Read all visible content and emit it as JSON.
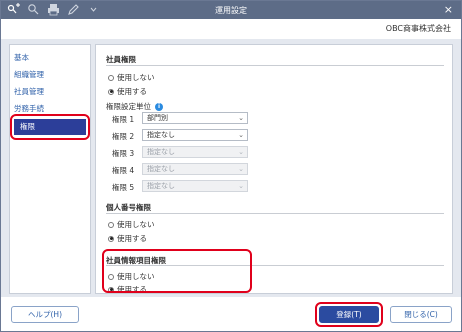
{
  "titlebar": {
    "title": "運用設定",
    "icons": [
      "key-plus-icon",
      "zoom-icon",
      "print-icon",
      "pencil-icon",
      "dropdown-icon"
    ],
    "close": "×"
  },
  "company": "OBC商事株式会社",
  "sidebar": {
    "items": [
      {
        "label": "基本"
      },
      {
        "label": "組織管理"
      },
      {
        "label": "社員管理"
      },
      {
        "label": "労務手続"
      },
      {
        "label": "権限"
      }
    ]
  },
  "employee_perm": {
    "title": "社員権限",
    "opt_off": "使用しない",
    "opt_on": "使用する",
    "selected": "on",
    "unit_label": "権限設定単位",
    "rows": [
      {
        "label": "権限 1",
        "value": "部門別",
        "disabled": false
      },
      {
        "label": "権限 2",
        "value": "指定なし",
        "disabled": false
      },
      {
        "label": "権限 3",
        "value": "指定なし",
        "disabled": true
      },
      {
        "label": "権限 4",
        "value": "指定なし",
        "disabled": true
      },
      {
        "label": "権限 5",
        "value": "指定なし",
        "disabled": true
      }
    ]
  },
  "mynumber_perm": {
    "title": "個人番号権限",
    "opt_off": "使用しない",
    "opt_on": "使用する",
    "selected": "on"
  },
  "info_item_perm": {
    "title": "社員情報項目権限",
    "opt_off": "使用しない",
    "opt_on": "使用する",
    "selected": "on"
  },
  "footer": {
    "help": "ヘルプ(H)",
    "register": "登録(T)",
    "close": "閉じる(C)"
  },
  "colors": {
    "titlebar": "#5d6c87",
    "active_nav": "#2c3e99",
    "primary_button": "#2b4ba0",
    "highlight": "#e0001b"
  }
}
